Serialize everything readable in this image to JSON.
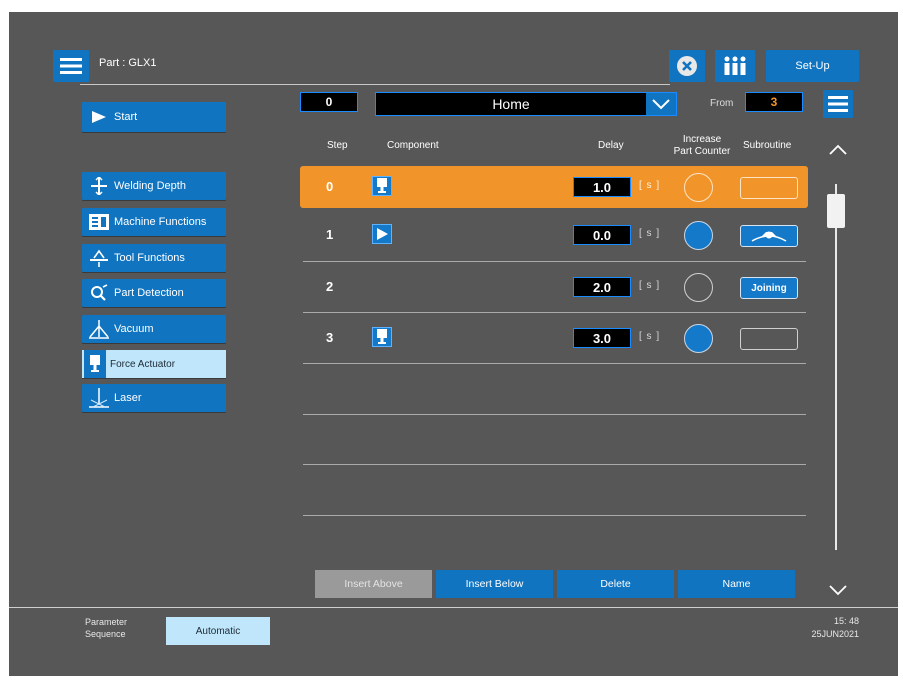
{
  "header": {
    "part_label": "Part : GLX1",
    "setup_label": "Set-Up"
  },
  "sidebar": {
    "start_label": "Start",
    "items": [
      {
        "label": "Welding Depth",
        "icon": "welding-depth-icon"
      },
      {
        "label": "Machine Functions",
        "icon": "machine-functions-icon"
      },
      {
        "label": "Tool Functions",
        "icon": "tool-functions-icon"
      },
      {
        "label": "Part Detection",
        "icon": "part-detection-icon"
      },
      {
        "label": "Vacuum",
        "icon": "vacuum-icon"
      },
      {
        "label": "Force Actuator",
        "icon": "force-actuator-icon",
        "selected": true
      },
      {
        "label": "Laser",
        "icon": "laser-icon"
      }
    ]
  },
  "sequence": {
    "number": "0",
    "name": "Home",
    "from_label": "From",
    "from_value": "3"
  },
  "columns": {
    "step": "Step",
    "component": "Component",
    "delay": "Delay",
    "increase_line1": "Increase",
    "increase_line2": "Part Counter",
    "subroutine": "Subroutine"
  },
  "steps": [
    {
      "step": "0",
      "component": "force-actuator",
      "delay": "1.0",
      "unit": "[ s ]",
      "counter_on": false,
      "subroutine": "",
      "selected": true
    },
    {
      "step": "1",
      "component": "start",
      "delay": "0.0",
      "unit": "[ s ]",
      "counter_on": true,
      "subroutine": "pickup-icon",
      "selected": false
    },
    {
      "step": "2",
      "component": "",
      "delay": "2.0",
      "unit": "[ s ]",
      "counter_on": false,
      "subroutine": "Joining",
      "selected": false
    },
    {
      "step": "3",
      "component": "force-actuator",
      "delay": "3.0",
      "unit": "[ s ]",
      "counter_on": true,
      "subroutine": "",
      "selected": false
    }
  ],
  "actions": {
    "insert_above": "Insert Above",
    "insert_below": "Insert Below",
    "delete": "Delete",
    "name": "Name"
  },
  "footer": {
    "mode_line1": "Parameter",
    "mode_line2": "Sequence",
    "mode_value": "Automatic",
    "time": "15: 48",
    "date": "25JUN2021"
  },
  "colors": {
    "background": "#575757",
    "accent": "#1074c0",
    "selected_row": "#f1952a",
    "highlight": "#bfe6fa"
  }
}
